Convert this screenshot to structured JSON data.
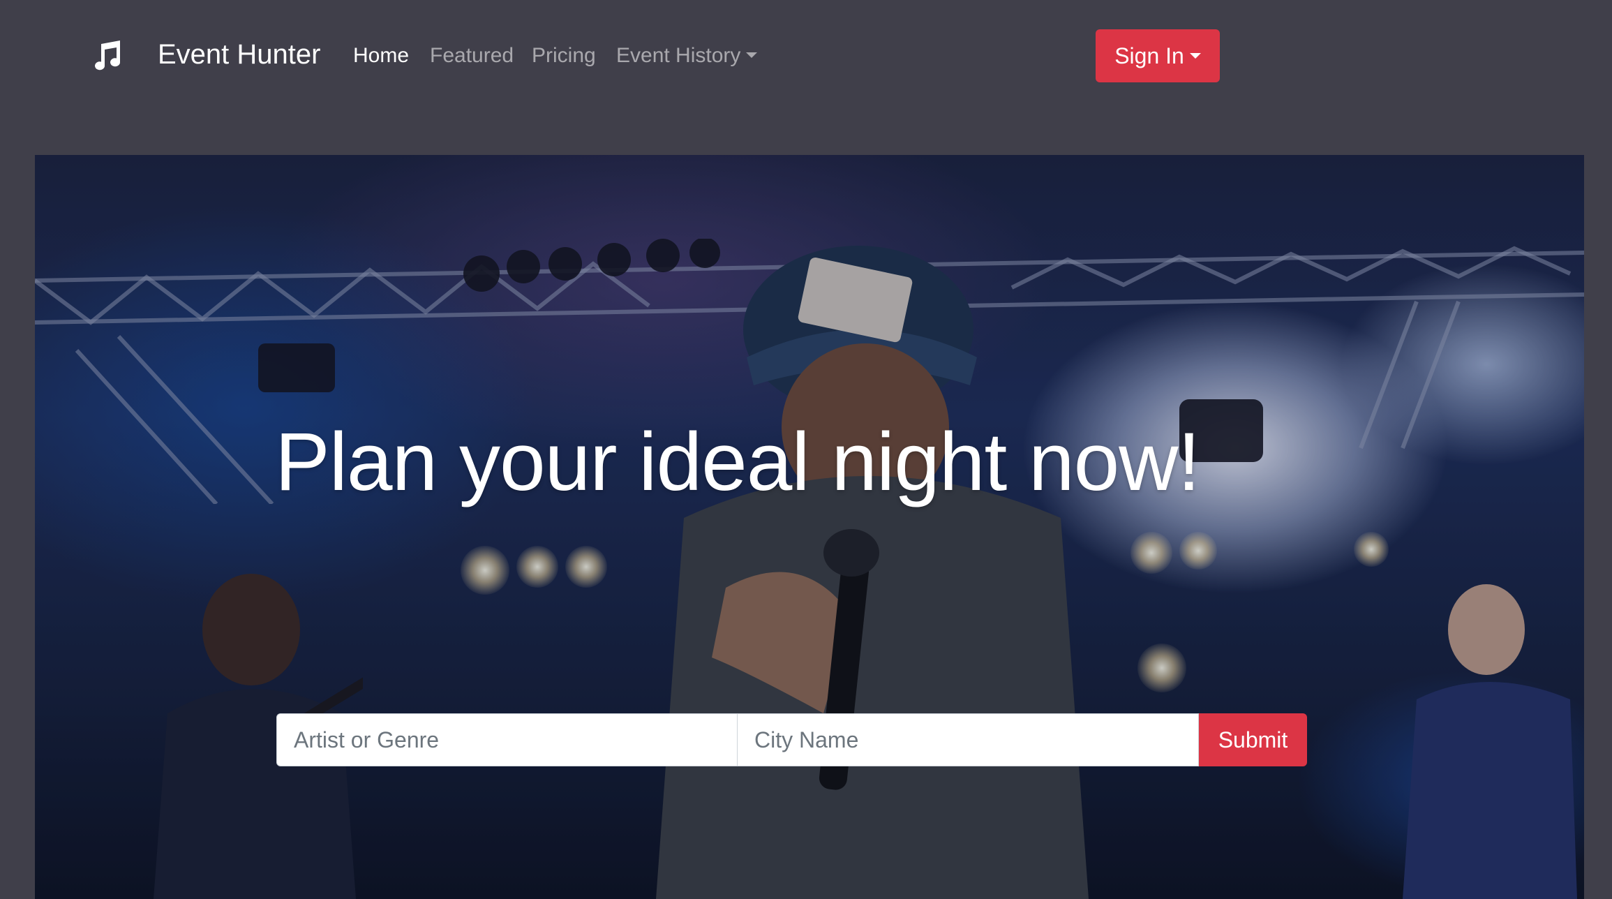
{
  "navbar": {
    "brand_icon": "music-note-icon",
    "brand_name": "Event Hunter",
    "links": [
      {
        "label": "Home",
        "active": true
      },
      {
        "label": "Featured",
        "active": false
      },
      {
        "label": "Pricing",
        "active": false
      },
      {
        "label": "Event History",
        "active": false,
        "dropdown": true
      }
    ],
    "sign_in_label": "Sign In"
  },
  "hero": {
    "title": "Plan your ideal night now!",
    "search": {
      "artist_placeholder": "Artist or Genre",
      "city_placeholder": "City Name",
      "submit_label": "Submit"
    }
  },
  "colors": {
    "background": "#403f4a",
    "accent": "#dc3545",
    "nav_active": "#ffffff",
    "nav_inactive": "rgba(255,255,255,0.55)"
  }
}
